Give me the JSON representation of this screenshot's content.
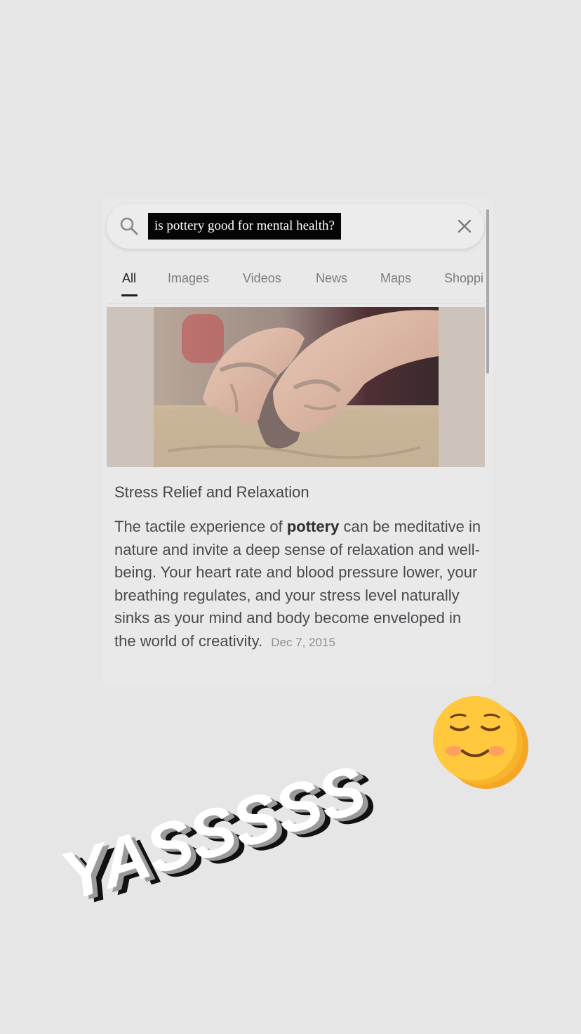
{
  "search": {
    "query": "is pottery good for mental health?",
    "icon": "search-icon",
    "clear_icon": "close-icon"
  },
  "tabs": [
    {
      "label": "All",
      "active": true
    },
    {
      "label": "Images"
    },
    {
      "label": "Videos"
    },
    {
      "label": "News"
    },
    {
      "label": "Maps"
    },
    {
      "label": "Shoppi"
    }
  ],
  "result": {
    "title": "Stress Relief and Relaxation",
    "body_before": "The tactile experience of ",
    "body_bold": "pottery",
    "body_after": " can be meditative in nature and invite a deep sense of relaxation and well-being. Your heart rate and blood pressure lower, your breathing regulates, and your stress level naturally sinks as your mind and body become enveloped in the world of creativity.",
    "date": "Dec 7, 2015"
  },
  "sticker": {
    "text": "YASSSSS",
    "emoji": "☺"
  },
  "colors": {
    "background": "#e6e6e6",
    "query_highlight": "#050505",
    "tab_active": "#202124",
    "tab_inactive": "#7b7c80"
  }
}
